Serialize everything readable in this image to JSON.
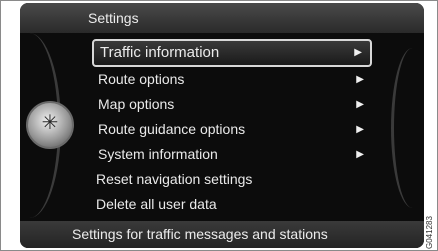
{
  "header": {
    "title": "Settings"
  },
  "menu": {
    "items": [
      {
        "label": "Traffic information",
        "arrow": "▶"
      },
      {
        "label": "Route options",
        "arrow": "▶"
      },
      {
        "label": "Map options",
        "arrow": "▶"
      },
      {
        "label": "Route guidance options",
        "arrow": "▶"
      },
      {
        "label": "System information",
        "arrow": "▶"
      },
      {
        "label": "Reset navigation settings"
      },
      {
        "label": "Delete all user data"
      }
    ]
  },
  "footer": {
    "text": "Settings for traffic messages and stations"
  },
  "figure_code": "G041283",
  "knob_icon": "✳",
  "colors": {
    "screen_bg": "#0c0c0c",
    "text": "#eaeaea",
    "selection_border": "#d8d8d8"
  }
}
